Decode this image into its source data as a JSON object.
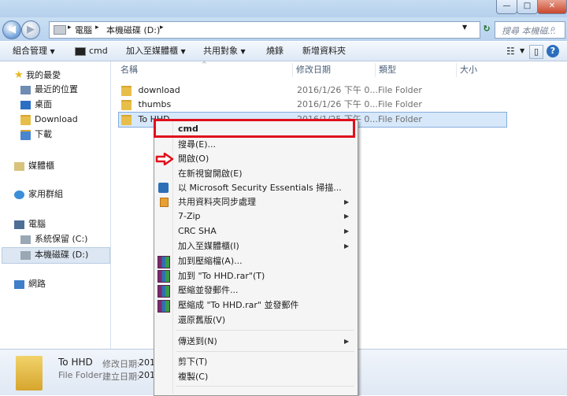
{
  "window": {
    "min_glyph": "—",
    "max_glyph": "□",
    "close_glyph": "✕"
  },
  "address": {
    "path": [
      "電腦",
      "本機磁碟 (D:)"
    ],
    "search_placeholder": "搜尋 本機磁..."
  },
  "toolbar": {
    "organize": "組合管理",
    "cmd": "cmd",
    "add_to_library": "加入至媒體櫃",
    "share_with": "共用對象",
    "burn": "燒錄",
    "new_folder": "新增資料夾"
  },
  "nav": {
    "favorites": "我的最愛",
    "recent": "最近的位置",
    "desktop": "桌面",
    "download": "Download",
    "downloads": "下載",
    "libraries": "媒體櫃",
    "homegroup": "家用群組",
    "computer": "電腦",
    "system_drive": "系統保留 (C:)",
    "local_disk": "本機磁碟 (D:)",
    "network": "網路"
  },
  "columns": {
    "name": "名稱",
    "date": "修改日期",
    "type": "類型",
    "size": "大小"
  },
  "files": [
    {
      "name": "download",
      "date": "2016/1/26 下午 0...",
      "type": "File Folder"
    },
    {
      "name": "thumbs",
      "date": "2016/1/26 下午 0...",
      "type": "File Folder"
    },
    {
      "name": "To HHD",
      "date": "2016/1/25 下午 0...",
      "type": "File Folder"
    }
  ],
  "details": {
    "name": "To HHD",
    "type": "File Folder",
    "modified_label": "修改日期:",
    "modified_value": "201",
    "created_label": "建立日期:",
    "created_value": "201"
  },
  "context_menu": {
    "items": [
      "cmd",
      "搜尋(E)...",
      "開啟(O)",
      "在新視窗開啟(E)",
      "以 Microsoft Security Essentials 掃描...",
      "共用資料夾同步處理",
      "7-Zip",
      "CRC SHA",
      "加入至媒體櫃(I)",
      "加到壓縮檔(A)...",
      "加到 \"To HHD.rar\"(T)",
      "壓縮並發郵件...",
      "壓縮成 \"To HHD.rar\" 並發郵件",
      "還原舊版(V)",
      "傳送到(N)",
      "剪下(T)",
      "複製(C)"
    ]
  },
  "colors": {
    "highlight": "#e1101c",
    "selection": "#d7e8fa"
  }
}
